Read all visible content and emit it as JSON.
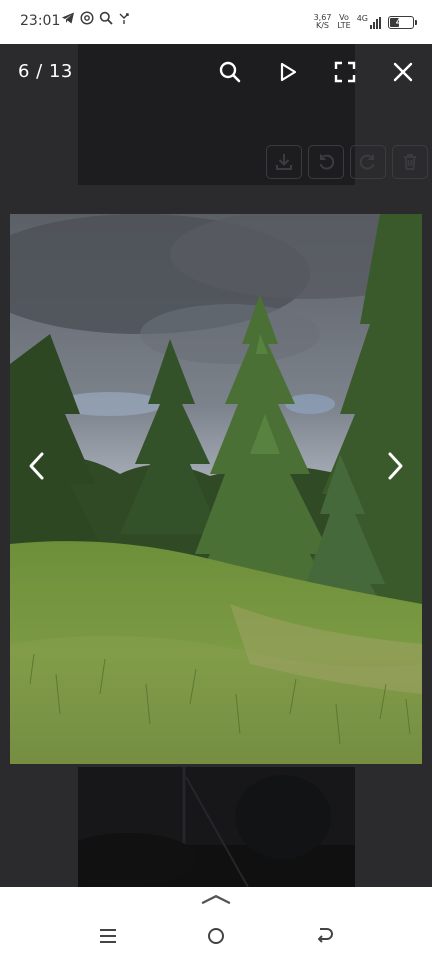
{
  "status_bar": {
    "time": "23:01",
    "notification_icons": [
      "telegram-icon",
      "at-sign-icon",
      "search-icon",
      "phone-missed-icon"
    ],
    "net_speed_value": "3,67",
    "net_speed_unit": "K/S",
    "volte_top": "Vo",
    "volte_bottom": "LTE",
    "network": "4G",
    "battery": "47",
    "battery_level_percent": 47
  },
  "viewer": {
    "counter": "6 / 13",
    "background": "#2b2b2e",
    "toolbar_icons": [
      "search-icon",
      "play-icon",
      "fullscreen-icon",
      "close-icon"
    ],
    "faded_tools": [
      "download-icon",
      "rotate-left-icon",
      "rotate-right-icon",
      "trash-icon"
    ],
    "photo": "pine-trees-meadow"
  },
  "nav_bar": {
    "buttons": [
      "menu-icon",
      "home-icon",
      "back-icon"
    ],
    "handle": "chevron-up-icon"
  }
}
